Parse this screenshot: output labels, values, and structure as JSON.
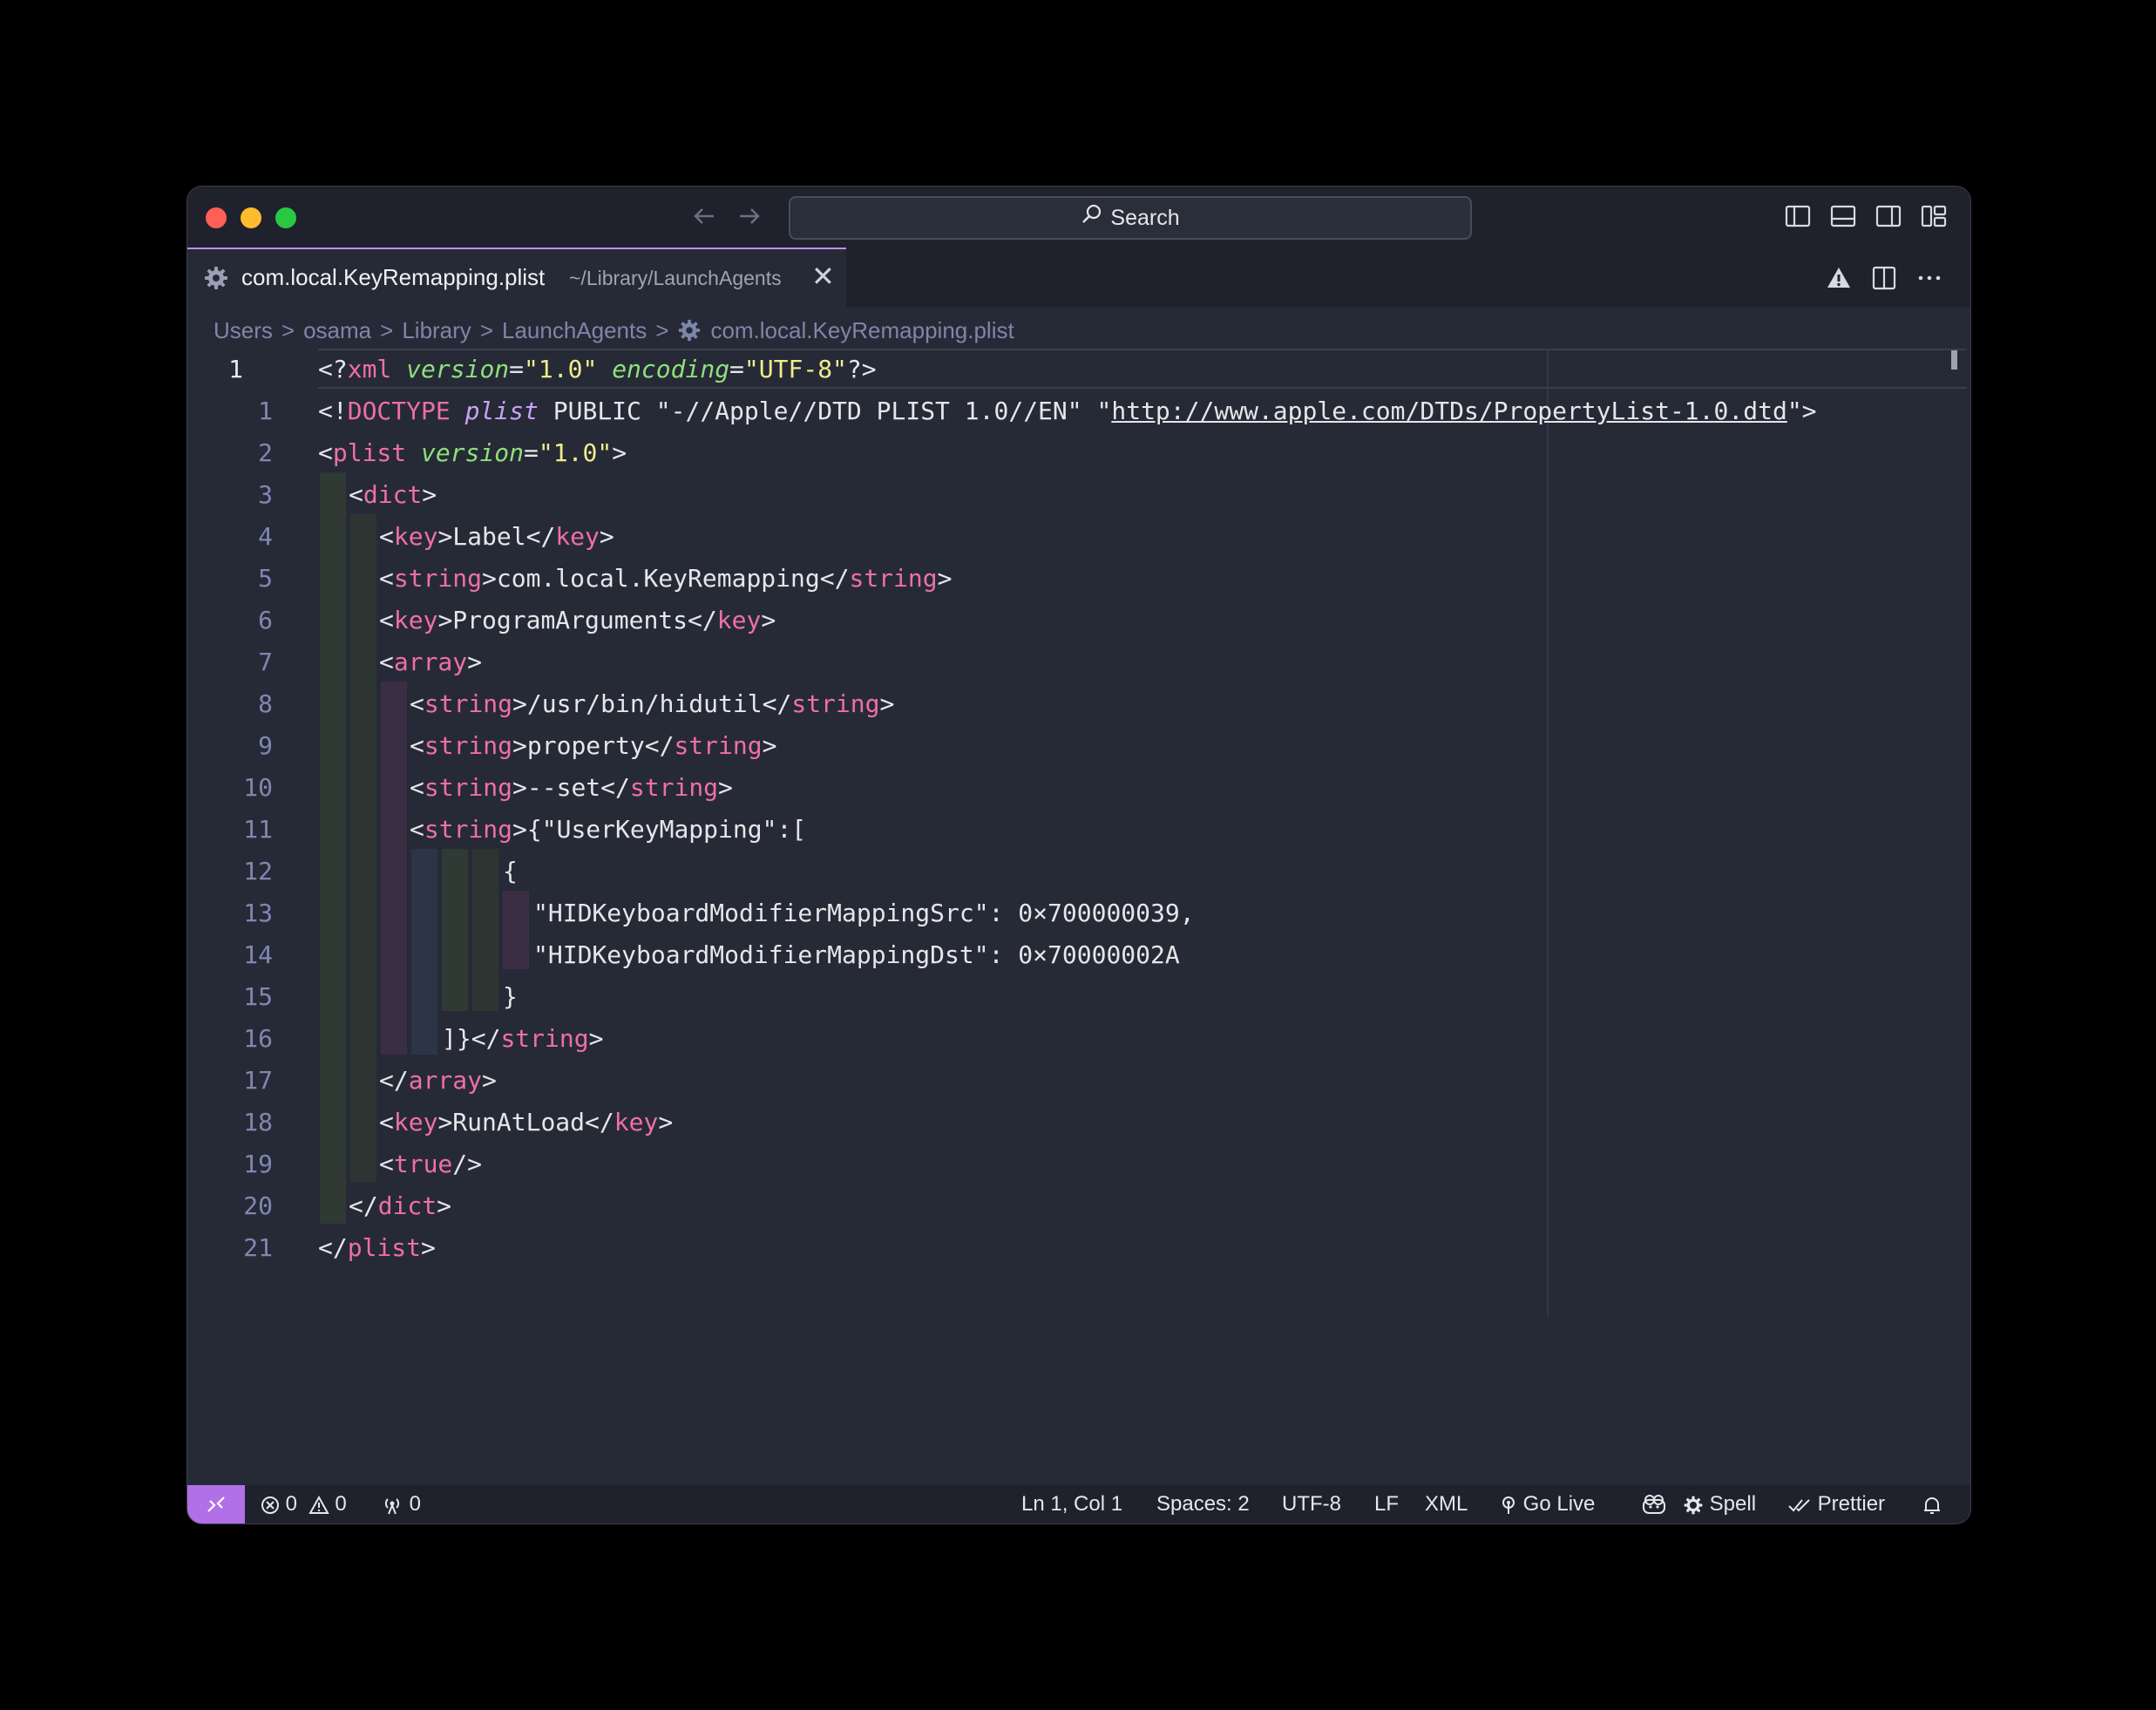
{
  "titlebar": {
    "search_placeholder": "Search"
  },
  "tab": {
    "file_name": "com.local.KeyRemapping.plist",
    "file_path": "~/Library/LaunchAgents",
    "close_glyph": "✕"
  },
  "tab_actions": [
    "triangle-warning-icon",
    "split-editor-icon",
    "more-actions-icon"
  ],
  "breadcrumb": {
    "items": [
      "Users",
      "osama",
      "Library",
      "LaunchAgents",
      "com.local.KeyRemapping.plist"
    ],
    "separator": ">"
  },
  "editor": {
    "lines": [
      {
        "number": "1",
        "current": true
      },
      {
        "number": "1"
      },
      {
        "number": "2"
      },
      {
        "number": "3"
      },
      {
        "number": "4"
      },
      {
        "number": "5"
      },
      {
        "number": "6"
      },
      {
        "number": "7"
      },
      {
        "number": "8"
      },
      {
        "number": "9"
      },
      {
        "number": "10"
      },
      {
        "number": "11"
      },
      {
        "number": "12"
      },
      {
        "number": "13"
      },
      {
        "number": "14"
      },
      {
        "number": "15"
      },
      {
        "number": "16"
      },
      {
        "number": "17"
      },
      {
        "number": "18"
      },
      {
        "number": "19"
      },
      {
        "number": "20"
      },
      {
        "number": "21"
      }
    ],
    "code": {
      "xml_decl": {
        "open": "<?",
        "tag": "xml",
        "attr1": "version",
        "eq": "=",
        "val1": "\"1.0\"",
        "attr2": "encoding",
        "val2": "\"UTF-8\"",
        "close": "?>"
      },
      "doctype": {
        "open": "<!",
        "keyword": "DOCTYPE",
        "name": "plist",
        "public": "PUBLIC",
        "fpi": "\"-//Apple//DTD PLIST 1.0//EN\"",
        "q": "\"",
        "url": "http://www.apple.com/DTDs/PropertyList-1.0.dtd",
        "end": "\">"
      },
      "plist_open": {
        "lt": "<",
        "tag": "plist",
        "attr": "version",
        "eq": "=",
        "val": "\"1.0\"",
        "gt": ">"
      },
      "dict_open": "dict",
      "key_label": "Label",
      "string_label_value": "com.local.KeyRemapping",
      "key_program_args": "ProgramArguments",
      "array_open": "array",
      "string_hidutil": "/usr/bin/hidutil",
      "string_property": "property",
      "string_set": "--set",
      "string_json_start": "{\"UserKeyMapping\":[",
      "json_brace_open": "{",
      "json_src": "\"HIDKeyboardModifierMappingSrc\": 0×700000039,",
      "json_dst": "\"HIDKeyboardModifierMappingDst\": 0×70000002A",
      "json_brace_close": "}",
      "string_json_end": "]}",
      "array_close": "array",
      "key_run_at_load": "RunAtLoad",
      "true_tag": "true",
      "dict_close": "dict",
      "plist_close": "plist",
      "tag_key": "key",
      "tag_string": "string"
    }
  },
  "statusbar": {
    "errors": "0",
    "warnings": "0",
    "ports": "0",
    "position": "Ln 1, Col 1",
    "spaces": "Spaces: 2",
    "encoding": "UTF-8",
    "eol": "LF",
    "language": "XML",
    "go_live": "Go Live",
    "spell": "Spell",
    "prettier": "Prettier"
  },
  "colors": {
    "tag": "#ee6fa8",
    "attribute": "#8fe07a",
    "string": "#f1ec8c",
    "doctype_name": "#c9a3f4",
    "accent": "#b16fe8"
  }
}
